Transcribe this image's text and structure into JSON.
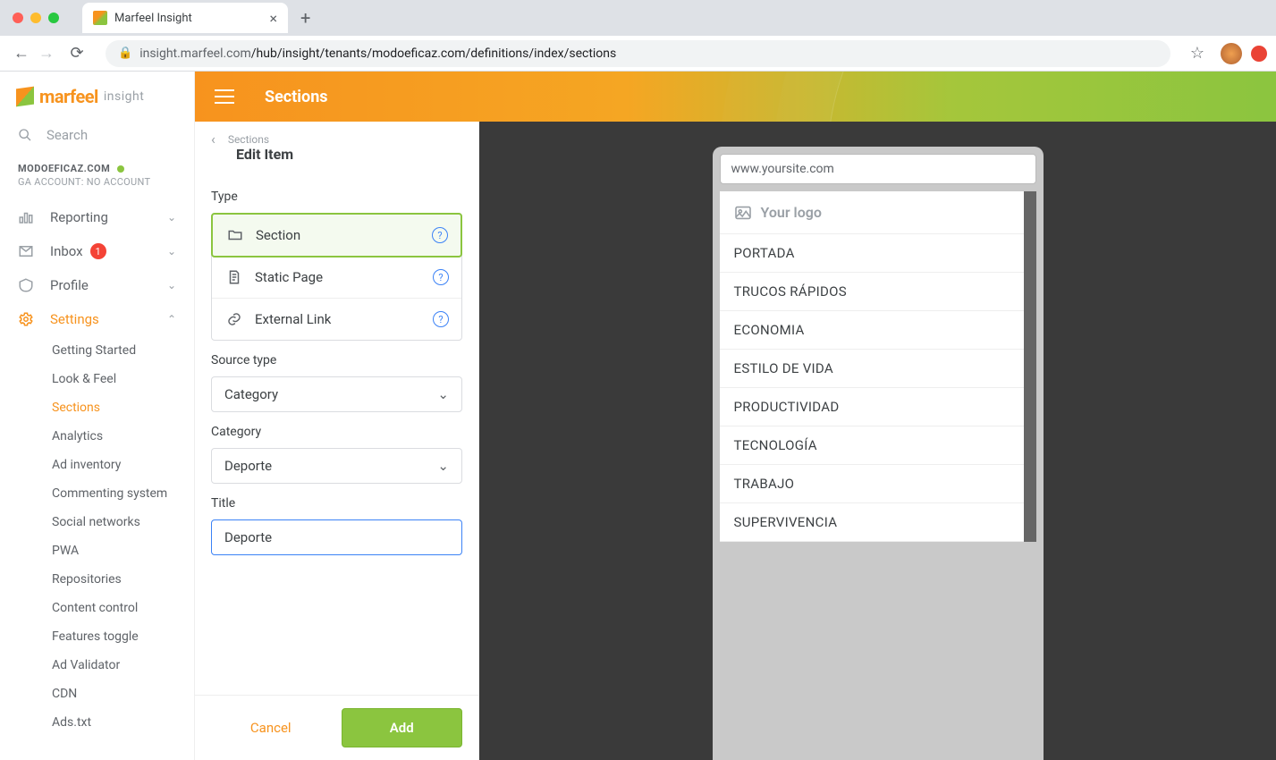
{
  "browser": {
    "tab_title": "Marfeel Insight",
    "url_host": "insight.marfeel.com",
    "url_path": "/hub/insight/tenants/modoeficaz.com/definitions/index/sections"
  },
  "brand": {
    "name": "marfeel",
    "suffix": "insight"
  },
  "topbar": {
    "title": "Sections"
  },
  "sidebar": {
    "search_placeholder": "Search",
    "tenant_name": "MODOEFICAZ.COM",
    "tenant_ga": "GA ACCOUNT: NO ACCOUNT",
    "items": {
      "reporting": "Reporting",
      "inbox": "Inbox",
      "inbox_count": "1",
      "profile": "Profile",
      "settings": "Settings"
    },
    "settings_children": {
      "getting_started": "Getting Started",
      "look_feel": "Look & Feel",
      "sections": "Sections",
      "analytics": "Analytics",
      "ad_inventory": "Ad inventory",
      "commenting": "Commenting system",
      "social": "Social networks",
      "pwa": "PWA",
      "repositories": "Repositories",
      "content_control": "Content control",
      "features_toggle": "Features toggle",
      "ad_validator": "Ad Validator",
      "cdn": "CDN",
      "ads_txt": "Ads.txt"
    }
  },
  "editor": {
    "breadcrumb": "Sections",
    "title": "Edit Item",
    "type_label": "Type",
    "types": {
      "section": "Section",
      "static_page": "Static Page",
      "external_link": "External Link"
    },
    "source_type_label": "Source type",
    "source_type_value": "Category",
    "category_label": "Category",
    "category_value": "Deporte",
    "title_label": "Title",
    "title_value": "Deporte",
    "cancel": "Cancel",
    "add": "Add"
  },
  "preview": {
    "url": "www.yoursite.com",
    "logo_label": "Your logo",
    "menu": [
      "PORTADA",
      "TRUCOS RÁPIDOS",
      "ECONOMIA",
      "ESTILO DE VIDA",
      "PRODUCTIVIDAD",
      "TECNOLOGÍA",
      "TRABAJO",
      "SUPERVIVENCIA"
    ]
  }
}
